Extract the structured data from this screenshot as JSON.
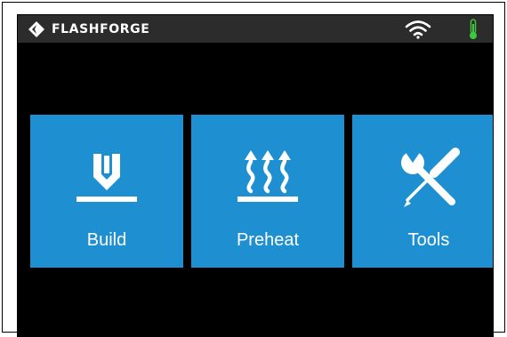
{
  "header": {
    "brand": "FLASHFORGE",
    "logo_icon": "flashforge-diamond-icon",
    "wifi_icon": "wifi-icon",
    "thermometer_icon": "thermometer-icon"
  },
  "tiles": [
    {
      "label": "Build",
      "icon": "build-icon"
    },
    {
      "label": "Preheat",
      "icon": "preheat-icon"
    },
    {
      "label": "Tools",
      "icon": "tools-icon"
    }
  ],
  "colors": {
    "tile": "#1e8fd0",
    "topbar": "#2c2c2c",
    "screen": "#000000",
    "thermometer": "#3dc83d"
  }
}
